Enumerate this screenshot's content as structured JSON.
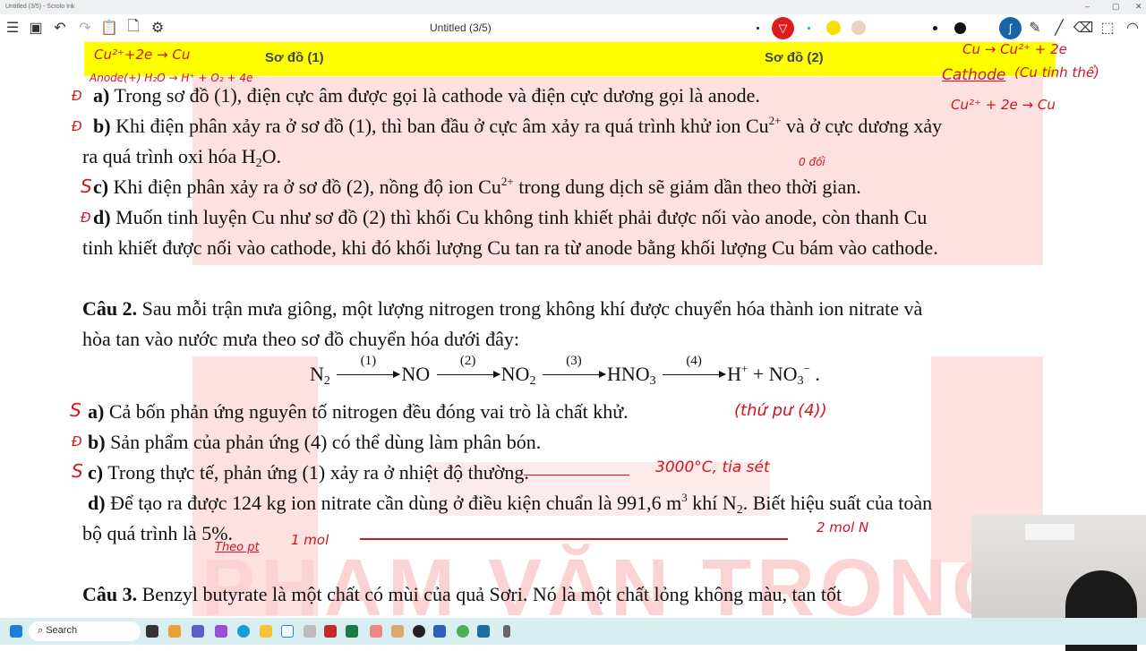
{
  "window": {
    "title": "Untitled (3/5) - Scrolo Ink",
    "min": "–",
    "max": "▢",
    "close": "✕"
  },
  "toolbar": {
    "doc_title": "Untitled (3/5)"
  },
  "colors": {
    "yellow": "#ffff00",
    "pen_red": "#e0141e",
    "pen_blue": "#1565a8",
    "watermark": "#fbd3d3"
  },
  "doc": {
    "sodo1": "Sơ đồ (1)",
    "sodo2": "Sơ đồ (2)",
    "watermark": "PHẠM VĂN TRỌNG",
    "q1": {
      "a": {
        "label": "a)",
        "text": " Trong sơ đồ (1), điện cực âm được gọi là cathode và điện cực dương gọi là anode."
      },
      "b": {
        "label": "b)",
        "t1": " Khi điện phân xảy ra ở sơ đồ (1), thì ban đầu ở cực âm xảy ra quá trình khử ion Cu",
        "sup": "2+",
        "t2": " và ở cực dương xảy",
        "t3": "ra quá trình oxi hóa H",
        "sub": "2",
        "t4": "O."
      },
      "c": {
        "label": "c)",
        "t1": " Khi điện phân xảy ra ở sơ đồ (2), nồng độ ion Cu",
        "sup": "2+",
        "t2": " trong dung dịch sẽ giảm dần theo thời gian."
      },
      "d": {
        "label": "d)",
        "t1": " Muốn tinh luyện Cu như sơ đồ (2) thì khối Cu không tinh khiết phải được nối vào anode, còn thanh Cu",
        "t2": "tinh khiết được nối vào cathode, khi đó khối lượng Cu tan ra từ anode bằng khối lượng Cu bám vào cathode."
      }
    },
    "q2": {
      "label": "Câu 2.",
      "t1": " Sau mỗi trận mưa giông, một lượng nitrogen trong không khí được chuyển hóa thành ion nitrate và",
      "t2": "hòa tan vào nước mưa theo sơ đồ chuyển hóa dưới đây:",
      "eq": {
        "n": "N",
        "n_sub": "2",
        "s1": "(1)",
        "no": "NO",
        "s2": "(2)",
        "no2": "NO",
        "no2_sub": "2",
        "s3": "(3)",
        "hno3": "HNO",
        "hno3_sub": "3",
        "s4": "(4)",
        "h": "H",
        "h_sup": "+",
        "plus": " + ",
        "no3": "NO",
        "no3_sub": "3",
        "no3_sup": "−",
        "end": " ."
      },
      "a": {
        "label": "a)",
        "text": " Cả bốn phản ứng nguyên tố nitrogen đều đóng vai trò là chất khử."
      },
      "b": {
        "label": "b)",
        "text": " Sản phẩm của phản ứng (4) có thể dùng làm phân bón."
      },
      "c": {
        "label": "c)",
        "text": " Trong thực tế, phản ứng (1) xảy ra ở nhiệt độ thường."
      },
      "d": {
        "label": "d)",
        "t1": " Để tạo ra được 124 kg ion nitrate cần dùng ở điều kiện chuẩn là 991,6 m",
        "sup": "3",
        "t2": " khí N",
        "sub": "2",
        "t3": ". Biết hiệu suất của toàn",
        "t4": "bộ quá trình là 5%."
      }
    },
    "q3": {
      "label": "Câu 3.",
      "text": " Benzyl butyrate là một chất có mùi của quả Sơri. Nó là một chất lỏng không màu, tan tốt"
    },
    "annotations": {
      "top1": "Cu²⁺+2e → Cu",
      "top2": "Anode(+) H₂O → H⁺ + O₂ + 4e",
      "r1": "Cu → Cu²⁺ + 2e",
      "r2": "Cathode",
      "r3": "(Cu tinh thể)",
      "r4": "Cu²⁺ + 2e → Cu",
      "mark_a": "Đ",
      "mark_b": "Đ",
      "mark_c": "S",
      "mark_d": "Đ",
      "c_note": "0 đổi",
      "q2a": "S",
      "q2b": "Đ",
      "q2c": "S",
      "q2a_note": "(thứ pư (4))",
      "q2c_note": "3000°C, tia sét",
      "theo_pt": "Theo pt",
      "one_mol": "1 mol",
      "two_mol": "2 mol N"
    }
  },
  "taskbar": {
    "search": "Search"
  }
}
